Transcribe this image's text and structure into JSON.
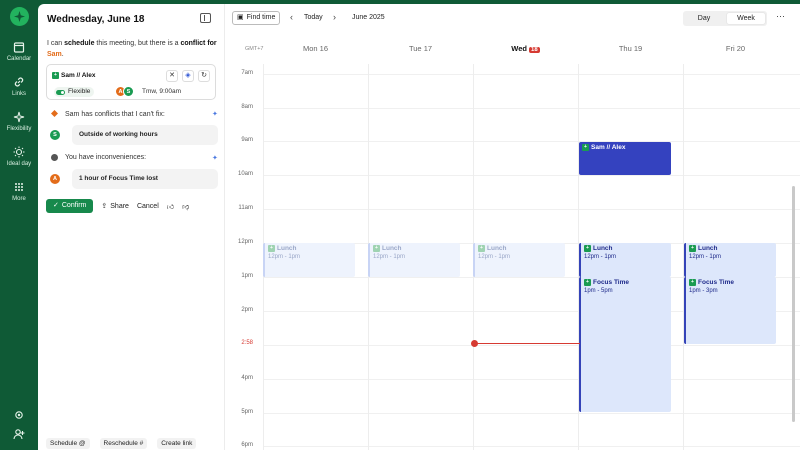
{
  "rail": {
    "items": [
      {
        "label": "Calendar",
        "icon": "calendar-icon"
      },
      {
        "label": "Links",
        "icon": "link-icon"
      },
      {
        "label": "Flexibility",
        "icon": "sparkle-icon"
      },
      {
        "label": "Ideal day",
        "icon": "sun-icon"
      },
      {
        "label": "More",
        "icon": "grid-icon"
      }
    ]
  },
  "panel": {
    "title": "Wednesday, June 18",
    "intro_pre": "I can ",
    "intro_b1": "schedule",
    "intro_mid": " this meeting, but there is a ",
    "intro_b2": "conflict",
    "intro_for": " for ",
    "intro_who": "Sam",
    "intro_end": ".",
    "event": {
      "title": "Sam // Alex",
      "flex_label": "Flexible",
      "avatars": [
        "A",
        "S"
      ],
      "time": "Tmw, 9:00am"
    },
    "conflicts_heading": "Sam has conflicts that I can't fix:",
    "conflict_item": {
      "badge": "S",
      "text": "Outside of working hours"
    },
    "inconv_heading": "You have inconveniences:",
    "inconv_item": {
      "badge": "A",
      "text": "1 hour of Focus Time lost"
    },
    "confirm_label": "Confirm",
    "share_label": "Share",
    "cancel_label": "Cancel",
    "footer": [
      "Schedule @",
      "Reschedule #",
      "Create link"
    ]
  },
  "toolbar": {
    "find_time": "Find time",
    "today": "Today",
    "month": "June 2025",
    "view_day": "Day",
    "view_week": "Week"
  },
  "calendar": {
    "timezone": "GMT+7",
    "days": [
      {
        "name": "Mon",
        "num": "16"
      },
      {
        "name": "Tue",
        "num": "17"
      },
      {
        "name": "Wed",
        "num": "18",
        "current": true
      },
      {
        "name": "Thu",
        "num": "19"
      },
      {
        "name": "Fri",
        "num": "20"
      }
    ],
    "hours": [
      "7am",
      "8am",
      "9am",
      "10am",
      "11am",
      "12pm",
      "1pm",
      "2pm",
      "2:58",
      "4pm",
      "5pm",
      "6pm"
    ],
    "now_label": "2:58",
    "events": [
      {
        "title": "Lunch",
        "time": "12pm - 1pm"
      },
      {
        "title": "Lunch",
        "time": "12pm - 1pm"
      },
      {
        "title": "Lunch",
        "time": "12pm - 1pm"
      },
      {
        "title": "Sam // Alex",
        "time": ""
      },
      {
        "title": "Lunch",
        "time": "12pm - 1pm"
      },
      {
        "title": "Focus Time",
        "time": "1pm - 5pm"
      },
      {
        "title": "Lunch",
        "time": "12pm - 1pm"
      },
      {
        "title": "Focus Time",
        "time": "1pm - 3pm"
      }
    ]
  },
  "colors": {
    "brand": "#0f5a36",
    "confirm": "#17894c",
    "event": "#3442bf",
    "now": "#d63a32",
    "conflict_person": "#e36c1a"
  }
}
